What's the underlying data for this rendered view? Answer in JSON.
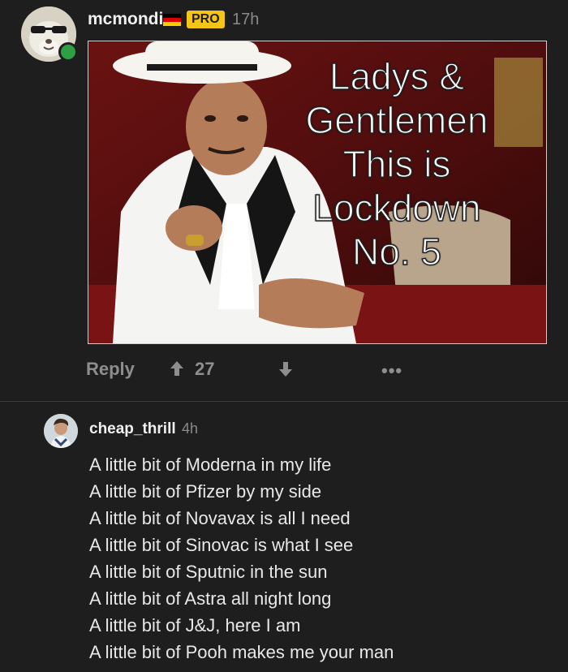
{
  "post": {
    "username": "mcmondi",
    "flag_icon": "german-flag-icon",
    "badge": "PRO",
    "time": "17h",
    "image": {
      "lines": [
        "Ladys &",
        "Gentlemen",
        "This is",
        "Lockdown",
        "No. 5"
      ]
    },
    "actions": {
      "reply_label": "Reply",
      "upvotes": "27",
      "more_label": "•••"
    }
  },
  "reply": {
    "username": "cheap_thrill",
    "time": "4h",
    "lines": [
      "A little bit of Moderna in my life",
      "A little bit of Pfizer by my side",
      "A little bit of Novavax is all I need",
      "A little bit of Sinovac is what I see",
      "A little bit of Sputnic in the sun",
      "A little bit of Astra all night long",
      "A little bit of J&J, here I am",
      "A little bit of Pooh makes me your man"
    ]
  },
  "colors": {
    "background": "#1e1e1e",
    "badge": "#f5c518",
    "online": "#2ea043",
    "muted": "#8e8e8e"
  }
}
